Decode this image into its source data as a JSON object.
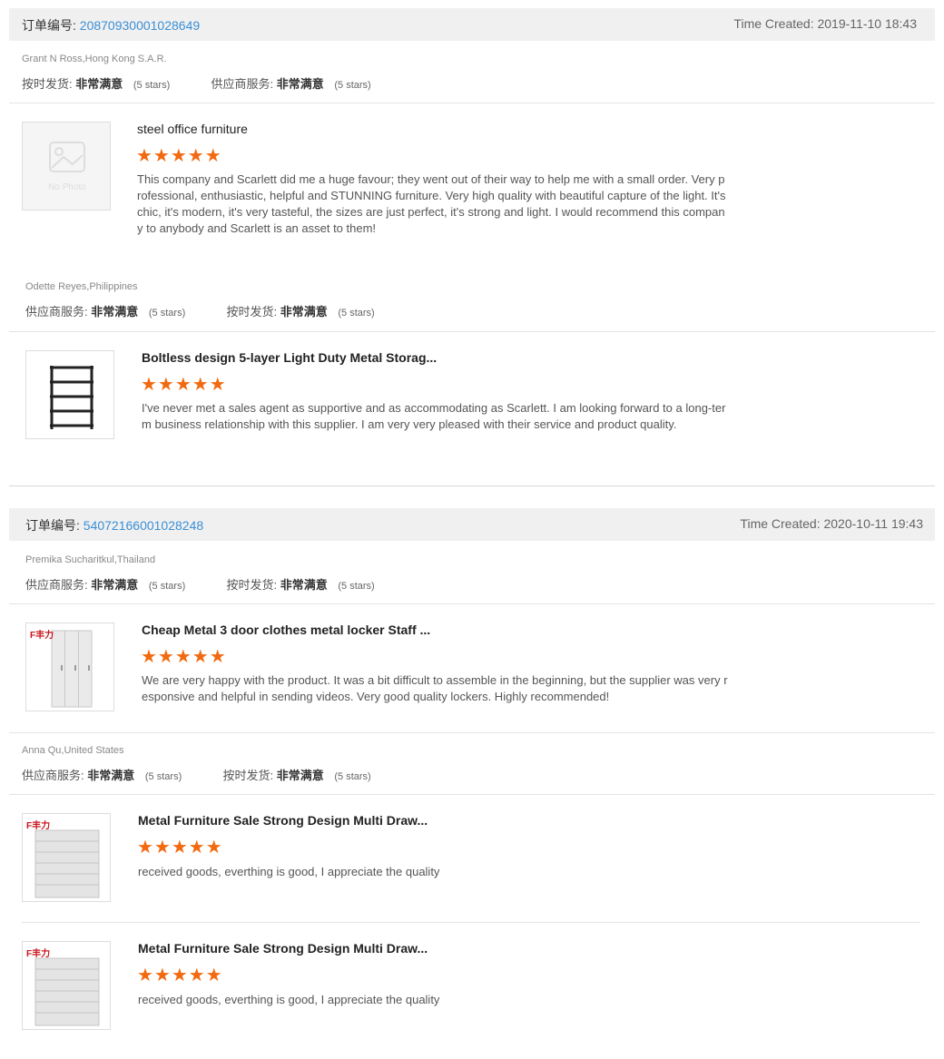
{
  "orders": [
    {
      "order_label": "订单编号:",
      "order_number": "20870930001028649",
      "time_created": "Time Created: 2019-11-10 18:43",
      "reviews": [
        {
          "buyer": "Grant N Ross,Hong Kong S.A.R.",
          "ratings": [
            {
              "label": "按时发货:",
              "value": "非常满意",
              "stars": "(5 stars)"
            },
            {
              "label": "供应商服务:",
              "value": "非常满意",
              "stars": "(5 stars)"
            }
          ],
          "products": [
            {
              "title": "steel office furniture",
              "stars": "★★★★★",
              "thumb_text": "No Photo",
              "text": "This company and Scarlett did me a huge favour; they went out of their way to help me with a small order. Very professional, enthusiastic, helpful and STUNNING furniture. Very high quality with beautiful capture of the light. It's chic, it's modern, it's very tasteful, the sizes are just perfect, it's strong and light. I would recommend this company to anybody and Scarlett is an asset to them!"
            }
          ]
        },
        {
          "buyer": "Odette Reyes,Philippines",
          "ratings": [
            {
              "label": "供应商服务:",
              "value": "非常满意",
              "stars": "(5 stars)"
            },
            {
              "label": "按时发货:",
              "value": "非常满意",
              "stars": "(5 stars)"
            }
          ],
          "products": [
            {
              "title": "Boltless design 5-layer Light Duty Metal Storag...",
              "stars": "★★★★★",
              "text": "I've never met a sales agent as supportive and as accommodating as Scarlett. I am looking forward to a long-term business relationship with this supplier. I am very very pleased with their service and product quality."
            }
          ]
        }
      ]
    },
    {
      "order_label": "订单编号:",
      "order_number": "54072166001028248",
      "time_created": "Time Created: 2020-10-11 19:43",
      "reviews": [
        {
          "buyer": "Premika Sucharitkul,Thailand",
          "ratings": [
            {
              "label": "供应商服务:",
              "value": "非常满意",
              "stars": "(5 stars)"
            },
            {
              "label": "按时发货:",
              "value": "非常满意",
              "stars": "(5 stars)"
            }
          ],
          "products": [
            {
              "title": "Cheap Metal 3 door clothes metal locker Staff ...",
              "stars": "★★★★★",
              "brand": "F丰力",
              "text": "We are very happy with the product. It was a bit difficult to assemble in the beginning, but the supplier was very responsive and helpful in sending videos. Very good quality lockers. Highly recommended!"
            }
          ]
        },
        {
          "buyer": "Anna Qu,United States",
          "ratings": [
            {
              "label": "供应商服务:",
              "value": "非常满意",
              "stars": "(5 stars)"
            },
            {
              "label": "按时发货:",
              "value": "非常满意",
              "stars": "(5 stars)"
            }
          ],
          "products": [
            {
              "title": "Metal Furniture Sale Strong Design Multi Draw...",
              "stars": "★★★★★",
              "brand": "F丰力",
              "text": "received goods, everthing is good, I appreciate the quality"
            },
            {
              "title": "Metal Furniture Sale Strong Design Multi Draw...",
              "stars": "★★★★★",
              "brand": "F丰力",
              "text": "received goods, everthing is good, I appreciate the quality"
            }
          ]
        }
      ]
    }
  ],
  "colors": {
    "link": "#3a8fd6",
    "star": "#f26a10",
    "header_bg": "#f0f0f0"
  },
  "icons": {
    "no_photo": "image-placeholder-icon",
    "shelf": "shelf-icon",
    "locker": "locker-icon",
    "cabinet": "drawer-cabinet-icon"
  }
}
